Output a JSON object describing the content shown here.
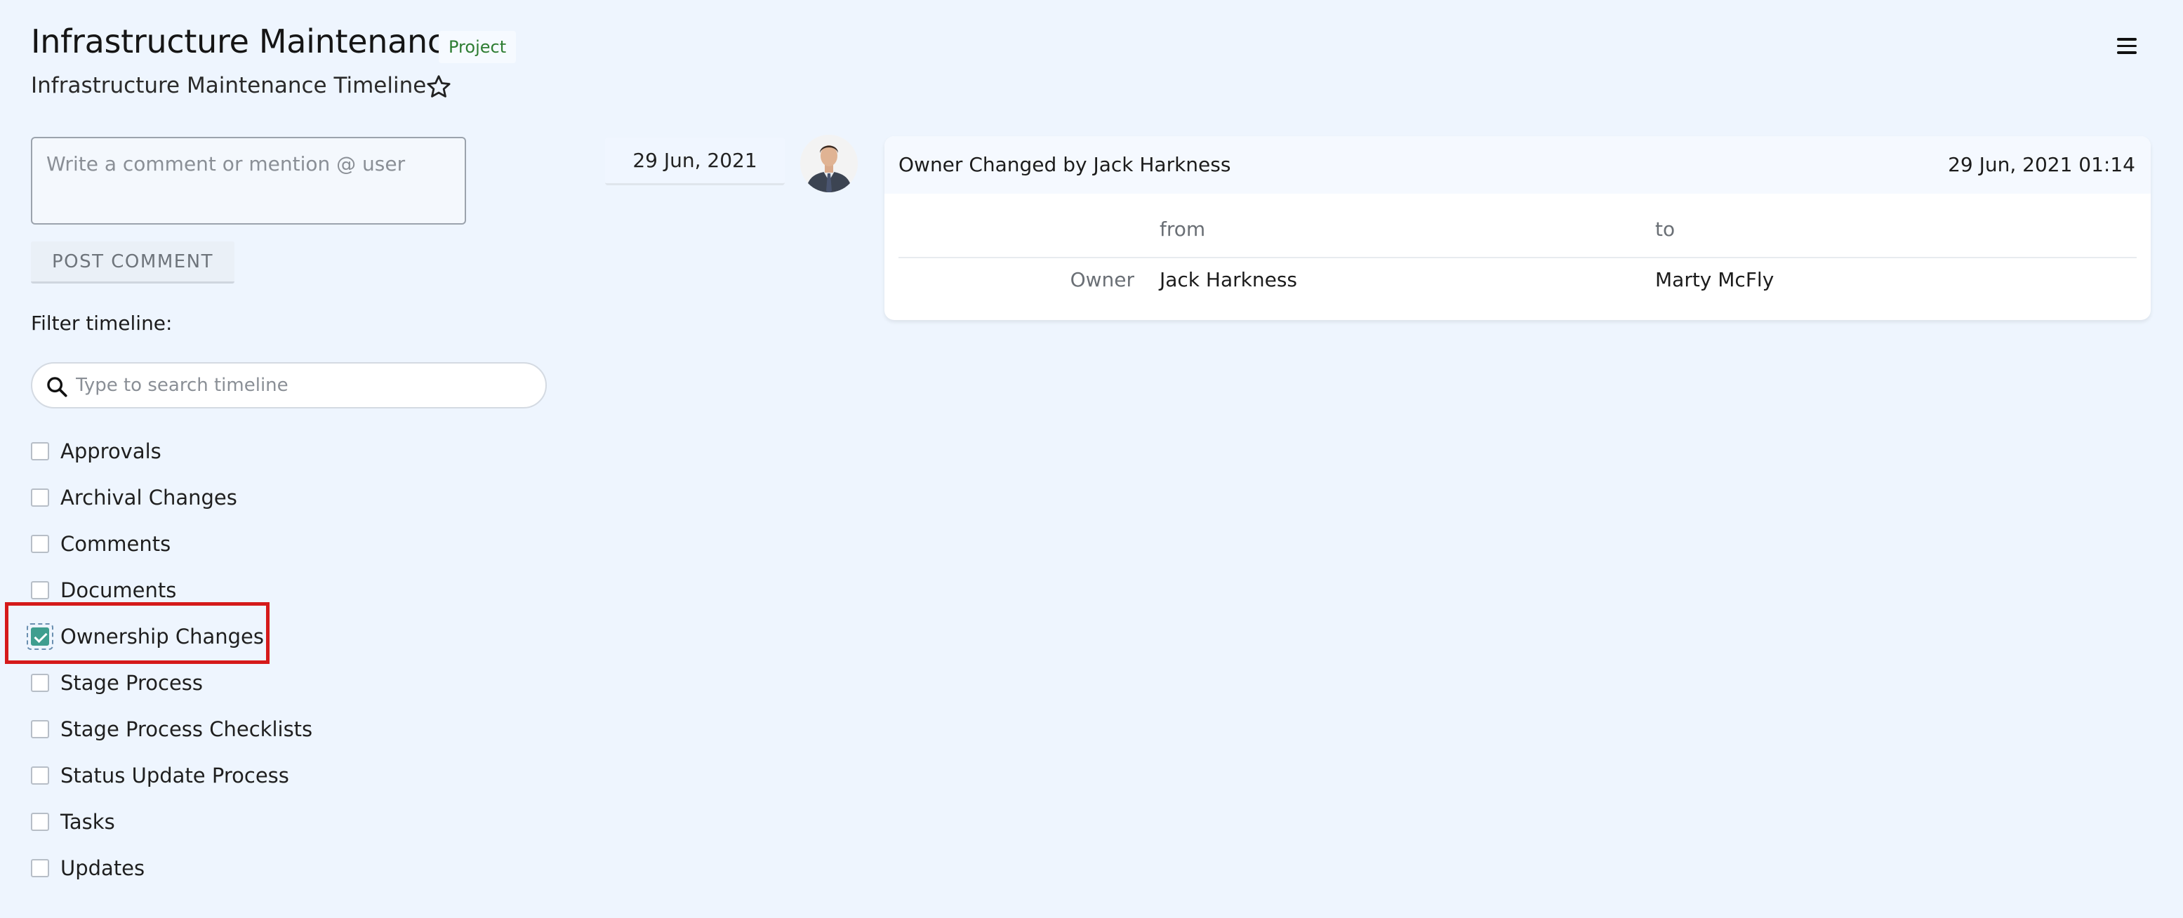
{
  "header": {
    "title": "Infrastructure Maintenance",
    "badge": "Project",
    "subtitle": "Infrastructure Maintenance Timeline"
  },
  "comment": {
    "placeholder": "Write a comment or mention @ user",
    "value": "",
    "post_label": "POST COMMENT"
  },
  "filter": {
    "label": "Filter timeline:",
    "search_placeholder": "Type to search timeline",
    "items": [
      {
        "label": "Approvals",
        "checked": false
      },
      {
        "label": "Archival Changes",
        "checked": false
      },
      {
        "label": "Comments",
        "checked": false
      },
      {
        "label": "Documents",
        "checked": false
      },
      {
        "label": "Ownership Changes",
        "checked": true
      },
      {
        "label": "Stage Process",
        "checked": false
      },
      {
        "label": "Stage Process Checklists",
        "checked": false
      },
      {
        "label": "Status Update Process",
        "checked": false
      },
      {
        "label": "Tasks",
        "checked": false
      },
      {
        "label": "Updates",
        "checked": false
      }
    ]
  },
  "timeline": {
    "date": "29 Jun, 2021",
    "event": {
      "title": "Owner Changed by Jack Harkness",
      "timestamp": "29 Jun, 2021 01:14",
      "col_from": "from",
      "col_to": "to",
      "row_label": "Owner",
      "from_value": "Jack Harkness",
      "to_value": "Marty McFly"
    }
  },
  "icons": {
    "star": "star-outline-icon",
    "menu": "hamburger-menu-icon",
    "search": "search-icon"
  },
  "colors": {
    "background": "#eef5fe",
    "badge_text": "#2e7d32",
    "checkbox_checked": "#3f9e8f",
    "highlight": "#d51a1a"
  }
}
